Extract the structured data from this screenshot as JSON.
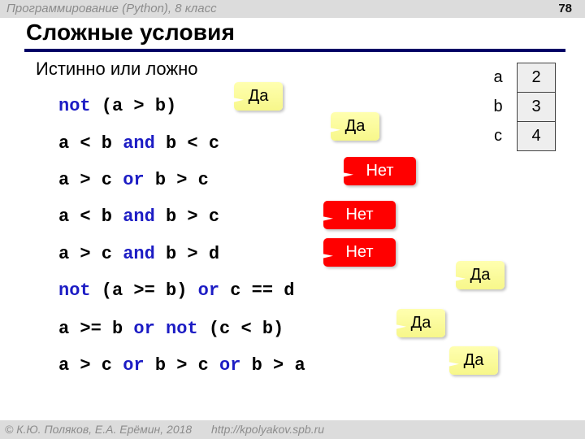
{
  "header": {
    "course_title": "Программирование (Python), 8 класс",
    "slide_number": "78"
  },
  "slide": {
    "title": "Сложные условия",
    "subtitle": "Истинно или ложно"
  },
  "expressions": [
    {
      "parts": [
        {
          "t": "not",
          "kw": true
        },
        {
          "t": " (a > b)",
          "kw": false
        }
      ],
      "answer": "Да",
      "result": "yes"
    },
    {
      "parts": [
        {
          "t": "a < b ",
          "kw": false
        },
        {
          "t": "and",
          "kw": true
        },
        {
          "t": " b < c",
          "kw": false
        }
      ],
      "answer": "Да",
      "result": "yes"
    },
    {
      "parts": [
        {
          "t": "a > c ",
          "kw": false
        },
        {
          "t": "or",
          "kw": true
        },
        {
          "t": " b > c",
          "kw": false
        }
      ],
      "answer": "Нет",
      "result": "no"
    },
    {
      "parts": [
        {
          "t": "a < b ",
          "kw": false
        },
        {
          "t": "and",
          "kw": true
        },
        {
          "t": " b > c",
          "kw": false
        }
      ],
      "answer": "Нет",
      "result": "no"
    },
    {
      "parts": [
        {
          "t": "a > c ",
          "kw": false
        },
        {
          "t": "and",
          "kw": true
        },
        {
          "t": " b > d",
          "kw": false
        }
      ],
      "answer": "Нет",
      "result": "no"
    },
    {
      "parts": [
        {
          "t": "not",
          "kw": true
        },
        {
          "t": " (a >= b) ",
          "kw": false
        },
        {
          "t": "or",
          "kw": true
        },
        {
          "t": " c == d",
          "kw": false
        }
      ],
      "answer": "Да",
      "result": "yes"
    },
    {
      "parts": [
        {
          "t": "a >= b ",
          "kw": false
        },
        {
          "t": "or",
          "kw": true
        },
        {
          "t": " ",
          "kw": false
        },
        {
          "t": "not",
          "kw": true
        },
        {
          "t": " (c < b)",
          "kw": false
        }
      ],
      "answer": "Да",
      "result": "yes"
    },
    {
      "parts": [
        {
          "t": "a > c ",
          "kw": false
        },
        {
          "t": "or",
          "kw": true
        },
        {
          "t": " b > c ",
          "kw": false
        },
        {
          "t": "or",
          "kw": true
        },
        {
          "t": " b > a",
          "kw": false
        }
      ],
      "answer": "Да",
      "result": "yes"
    }
  ],
  "variables": [
    {
      "name": "a",
      "value": "2"
    },
    {
      "name": "b",
      "value": "3"
    },
    {
      "name": "c",
      "value": "4"
    }
  ],
  "footer": {
    "copyright": "© К.Ю. Поляков, Е.А. Ерёмин, 2018",
    "url": "http://kpolyakov.spb.ru"
  },
  "colors": {
    "keyword": "#1c1cc4",
    "yes_callout": "#ffff99",
    "no_callout": "#ff0000",
    "title_rule": "#000066"
  }
}
